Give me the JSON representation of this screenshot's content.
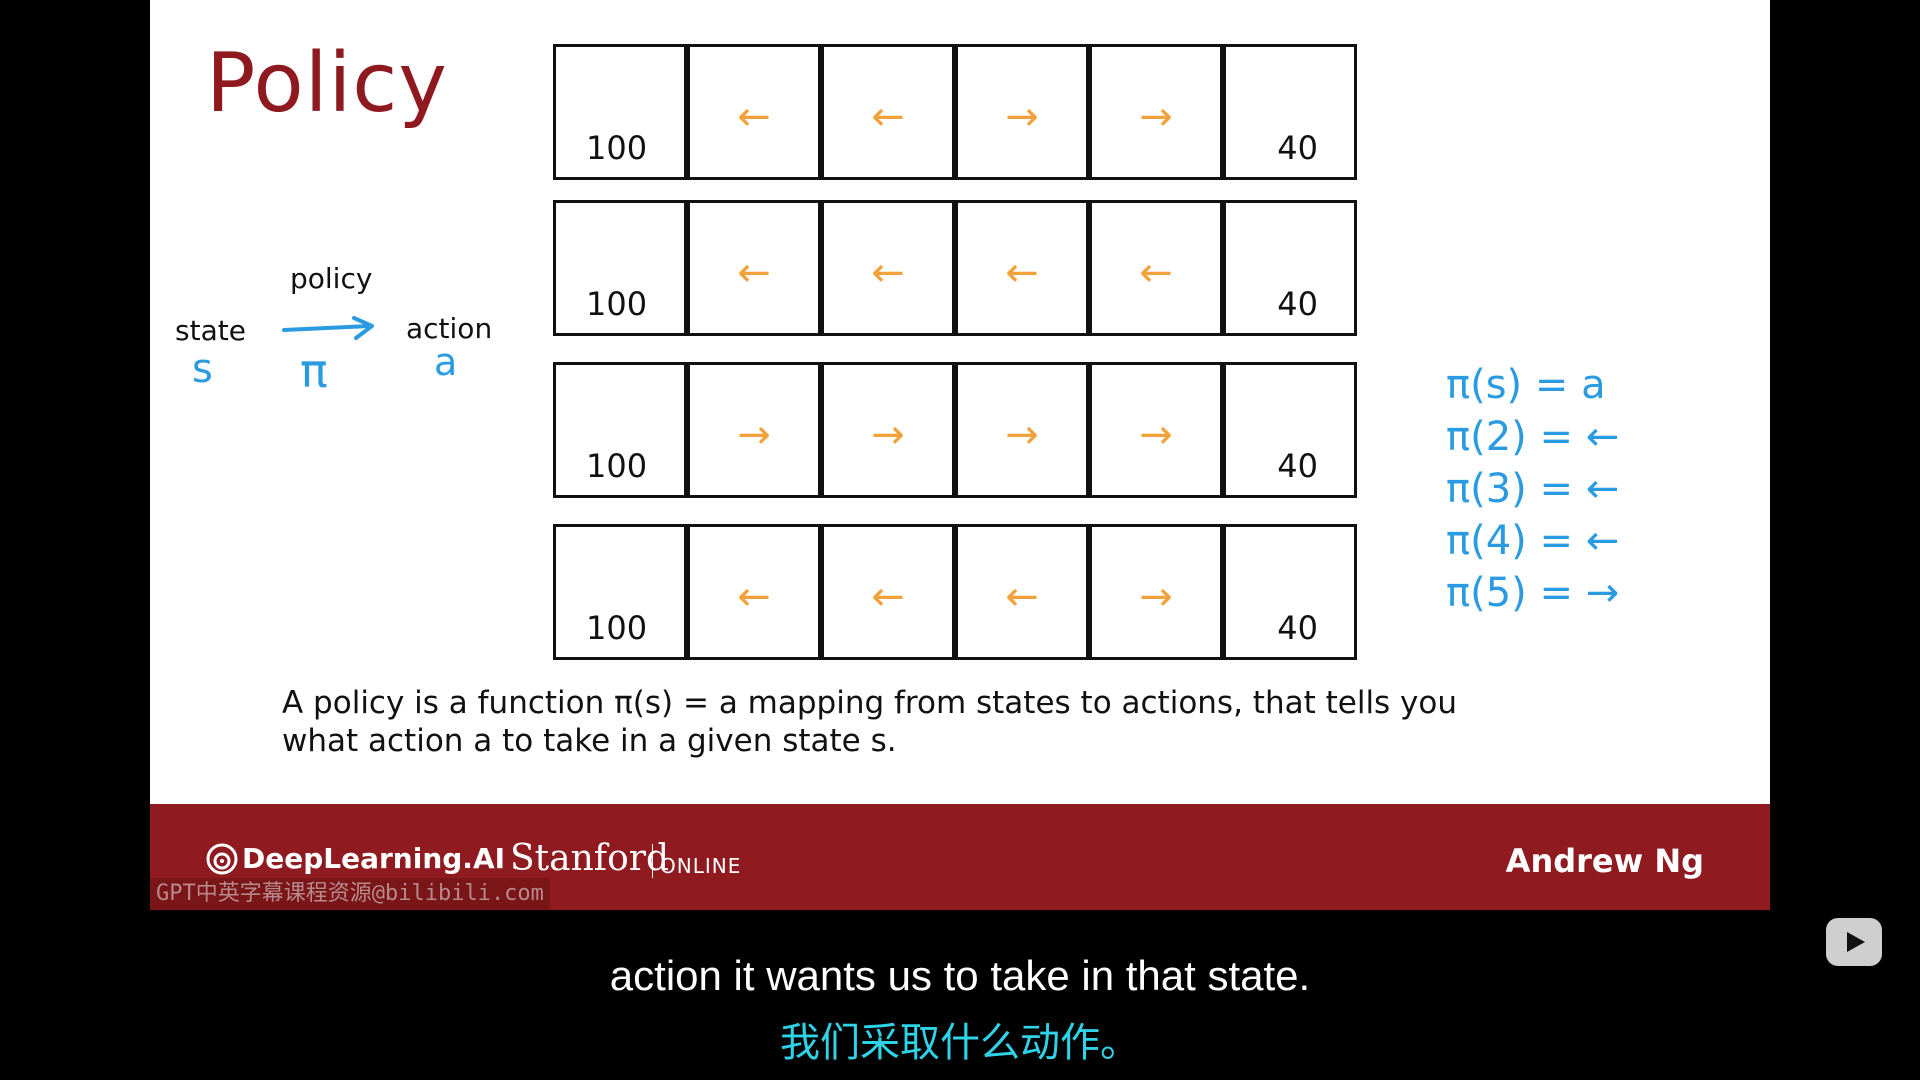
{
  "slide": {
    "title": "Policy",
    "diagram": {
      "policy_label": "policy",
      "state_label": "state",
      "action_label": "action",
      "s_symbol": "s",
      "pi_symbol": "π",
      "a_symbol": "a"
    },
    "grids": [
      {
        "cells": [
          {
            "value": "100",
            "arrow": ""
          },
          {
            "value": "",
            "arrow": "←"
          },
          {
            "value": "",
            "arrow": "←"
          },
          {
            "value": "",
            "arrow": "→"
          },
          {
            "value": "",
            "arrow": "→"
          },
          {
            "value": "40",
            "arrow": ""
          }
        ]
      },
      {
        "cells": [
          {
            "value": "100",
            "arrow": ""
          },
          {
            "value": "",
            "arrow": "←"
          },
          {
            "value": "",
            "arrow": "←"
          },
          {
            "value": "",
            "arrow": "←"
          },
          {
            "value": "",
            "arrow": "←"
          },
          {
            "value": "40",
            "arrow": ""
          }
        ]
      },
      {
        "cells": [
          {
            "value": "100",
            "arrow": ""
          },
          {
            "value": "",
            "arrow": "→"
          },
          {
            "value": "",
            "arrow": "→"
          },
          {
            "value": "",
            "arrow": "→"
          },
          {
            "value": "",
            "arrow": "→"
          },
          {
            "value": "40",
            "arrow": ""
          }
        ]
      },
      {
        "cells": [
          {
            "value": "100",
            "arrow": ""
          },
          {
            "value": "",
            "arrow": "←"
          },
          {
            "value": "",
            "arrow": "←"
          },
          {
            "value": "",
            "arrow": "←"
          },
          {
            "value": "",
            "arrow": "→"
          },
          {
            "value": "40",
            "arrow": ""
          }
        ]
      }
    ],
    "handwritten_equations": [
      "π(s) = a",
      "π(2) = ←",
      "π(3) = ←",
      "π(4) = ←",
      "π(5) = →"
    ],
    "caption_line1": "A policy is a function π(s) = a mapping from states to actions, that tells you",
    "caption_line2": "what action a to take in a given state s."
  },
  "banner": {
    "deeplearning_logo": "DeepLearning.AI",
    "stanford": "Stanford",
    "stanford_online": "ONLINE",
    "author": "Andrew Ng"
  },
  "watermark": "GPT中英字幕课程资源@bilibili.com",
  "subtitles": {
    "english": "action it wants us to take in that state.",
    "chinese": "我们采取什么动作。"
  },
  "icons": {
    "play": "bilibili-play-icon",
    "logo": "deeplearning-logo-icon"
  },
  "colors": {
    "title": "#8e1a1f",
    "banner": "#8f1a1f",
    "handwriting": "#2a9be0",
    "arrows": "#f2a23a",
    "subtitle_zh": "#2fd3e8"
  }
}
